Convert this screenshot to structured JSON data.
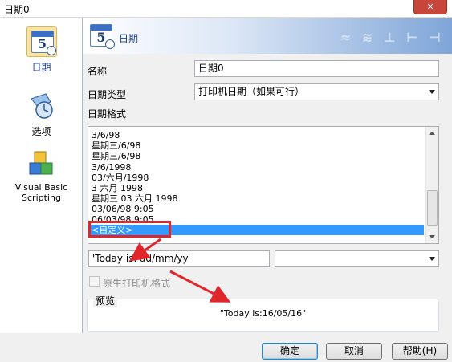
{
  "window": {
    "title": "日期0",
    "close_label": "✕"
  },
  "nav": {
    "items": [
      {
        "label": "日期",
        "icon": "calendar-icon",
        "selected": true
      },
      {
        "label": "选项",
        "icon": "settings-icon",
        "selected": false
      },
      {
        "label": "Visual Basic Scripting",
        "icon": "vbscript-icon",
        "selected": false
      }
    ]
  },
  "header": {
    "title": "日期"
  },
  "form": {
    "name_label": "名称",
    "name_value": "日期0",
    "type_label": "日期类型",
    "type_value": "打印机日期（如果可行）",
    "format_label": "日期格式",
    "format_items": [
      "3/6/98",
      "星期三/6/98",
      "星期三/6/98",
      "3/6/1998",
      "03/六月/1998",
      "3 六月 1998",
      "星期三 03 六月 1998",
      "03/06/98 9:05",
      "06/03/98 9:05",
      "<自定义>"
    ],
    "selected_format_index": 9,
    "custom_format_value": "'Today is:'dd/mm/yy",
    "custom_combo_value": "",
    "native_printer_label": "原生打印机格式",
    "preview_label": "预览",
    "preview_value": "\"Today is:16/05/16\""
  },
  "buttons": {
    "ok": "确定",
    "cancel": "取消",
    "help": "帮助(H)"
  },
  "colors": {
    "selection": "#3399ff",
    "annotation": "#e0262b",
    "accent": "#1b3f8a"
  }
}
